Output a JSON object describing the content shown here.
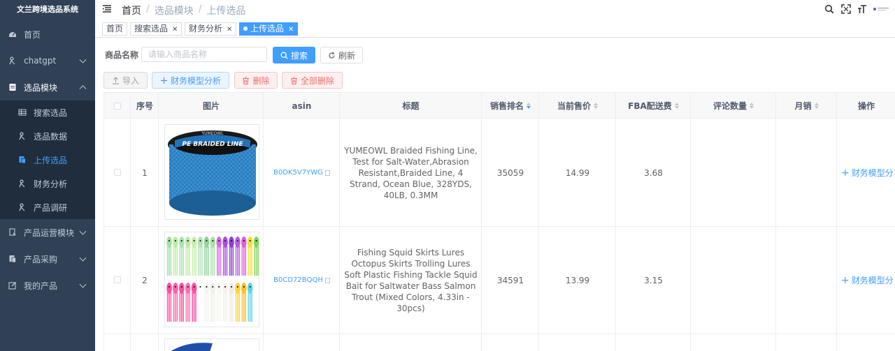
{
  "sidebar": {
    "title": "文兰跨境选品系统",
    "items": [
      {
        "label": "首页",
        "icon": "dashboard-icon"
      },
      {
        "label": "chatgpt",
        "icon": "chatgpt-icon"
      },
      {
        "label": "选品模块",
        "icon": "document-icon"
      },
      {
        "label": "产品运营模块",
        "icon": "operations-icon"
      },
      {
        "label": "产品采购",
        "icon": "purchase-icon"
      },
      {
        "label": "我的产品",
        "icon": "edit-icon"
      }
    ],
    "subitems": [
      {
        "label": "搜索选品",
        "icon": "table-icon"
      },
      {
        "label": "选品数据",
        "icon": "data-icon"
      },
      {
        "label": "上传选品",
        "icon": "upload-doc-icon"
      },
      {
        "label": "财务分析",
        "icon": "finance-icon"
      },
      {
        "label": "产品调研",
        "icon": "research-icon"
      }
    ]
  },
  "header": {
    "breadcrumb": [
      "首页",
      "选品模块",
      "上传选品"
    ]
  },
  "tags": [
    {
      "label": "首页",
      "closable": false,
      "active": false
    },
    {
      "label": "搜索选品",
      "closable": true,
      "active": false
    },
    {
      "label": "财务分析",
      "closable": true,
      "active": false
    },
    {
      "label": "上传选品",
      "closable": true,
      "active": true
    }
  ],
  "search": {
    "label": "商品名称",
    "placeholder": "请输入商品名称",
    "search_button": "搜索",
    "refresh_button": "刷新"
  },
  "toolbar": {
    "import_label": "导入",
    "analyze_label": "财务模型分析",
    "delete_label": "删除",
    "delete_all_label": "全部删除"
  },
  "table": {
    "columns": [
      "序号",
      "图片",
      "asin",
      "标题",
      "销售排名",
      "当前售价",
      "FBA配送费",
      "评论数量",
      "月销",
      "操作"
    ],
    "rows": [
      {
        "index": "1",
        "image": "blue braided fishing line spool",
        "asin": "B0DK5V7YWG",
        "title": "YUMEOWL Braided Fishing Line, Test for Salt-Water,Abrasion Resistant,Braided Line, 4 Strand, Ocean Blue, 328YDS, 40LB, 0.3MM",
        "rank": "35059",
        "price": "14.99",
        "fba": "3.68",
        "reviews": "",
        "monthly": "",
        "action": "财务模型分"
      },
      {
        "index": "2",
        "image": "colorful squid skirt lures",
        "asin": "B0CD72BQQH",
        "title": "Fishing Squid Skirts Lures Octopus Skirts Trolling Lures Soft Plastic Fishing Tackle Squid Bait for Saltwater Bass Salmon Trout (Mixed Colors, 4.33in - 30pcs)",
        "rank": "34591",
        "price": "13.99",
        "fba": "3.15",
        "reviews": "",
        "monthly": "",
        "action": "财务模型分"
      }
    ]
  },
  "spool_label": "PE BRAIDED LINE",
  "spool_brand": "YUMEOWL",
  "colors": {
    "sidebar_bg": "#304156",
    "submenu_bg": "#1f2d3d",
    "primary": "#409eff",
    "danger": "#f56c6c"
  }
}
